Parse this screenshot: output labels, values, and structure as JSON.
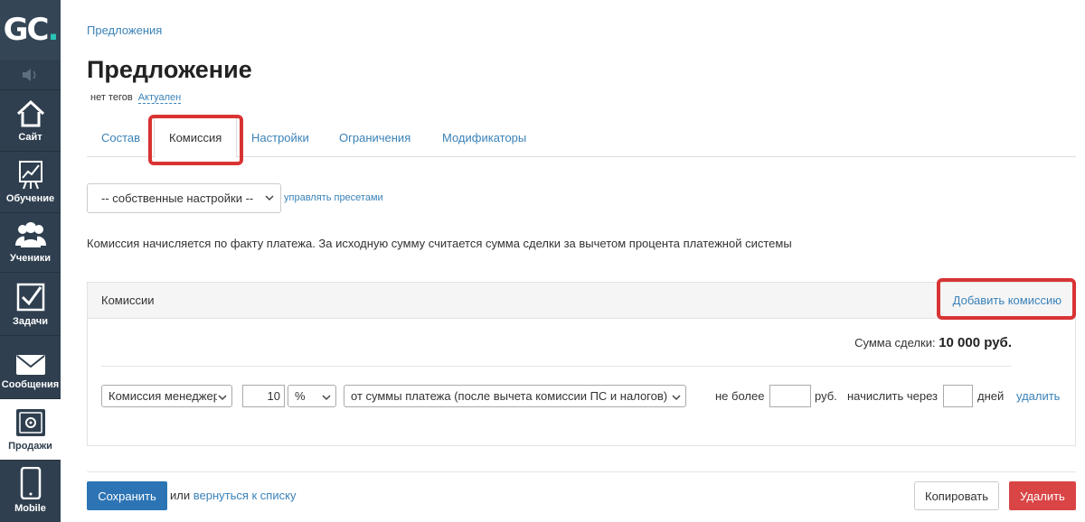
{
  "sidebar": {
    "logo_text": "GC",
    "logo_dot": ".",
    "items": [
      {
        "label": "Сайт",
        "icon": "home-icon"
      },
      {
        "label": "Обучение",
        "icon": "chart-board-icon"
      },
      {
        "label": "Ученики",
        "icon": "users-icon"
      },
      {
        "label": "Задачи",
        "icon": "checkbox-icon"
      },
      {
        "label": "Сообщения",
        "icon": "envelope-icon"
      },
      {
        "label": "Продажи",
        "icon": "safe-icon"
      },
      {
        "label": "Mobile",
        "icon": "phone-icon"
      }
    ]
  },
  "breadcrumb": "Предложения",
  "title": "Предложение",
  "tags": {
    "no_tags": "нет тегов",
    "status": "Актуален"
  },
  "tabs": [
    "Состав",
    "Комиссия",
    "Настройки",
    "Ограничения",
    "Модификаторы"
  ],
  "active_tab": "Комиссия",
  "preset": {
    "selected": "-- собственные настройки --",
    "manage_link": "управлять пресетами"
  },
  "info_text": "Комиссия начисляется по факту платежа. За исходную сумму считается сумма сделки за вычетом процента платежной системы",
  "commissions": {
    "title": "Комиссии",
    "add_label": "Добавить комиссию",
    "deal_sum_label": "Сумма сделки:",
    "deal_sum_value": "10 000 руб.",
    "row": {
      "type": "Комиссия менеджера",
      "amount": "10",
      "unit": "%",
      "base": "от суммы платежа (после вычета комиссии ПС и налогов)",
      "max_label": "не более",
      "max_value": "",
      "currency": "руб.",
      "delay_label": "начислить через",
      "delay_value": "",
      "days_label": "дней",
      "delete_label": "удалить"
    }
  },
  "footer": {
    "save": "Сохранить",
    "or": "или",
    "back_link": "вернуться к списку",
    "copy": "Копировать",
    "delete": "Удалить"
  },
  "colors": {
    "accent": "#2c74b4",
    "link": "#3a82b8",
    "danger": "#d94545",
    "highlight": "#d93333",
    "sidebar": "#2f3f4f"
  }
}
